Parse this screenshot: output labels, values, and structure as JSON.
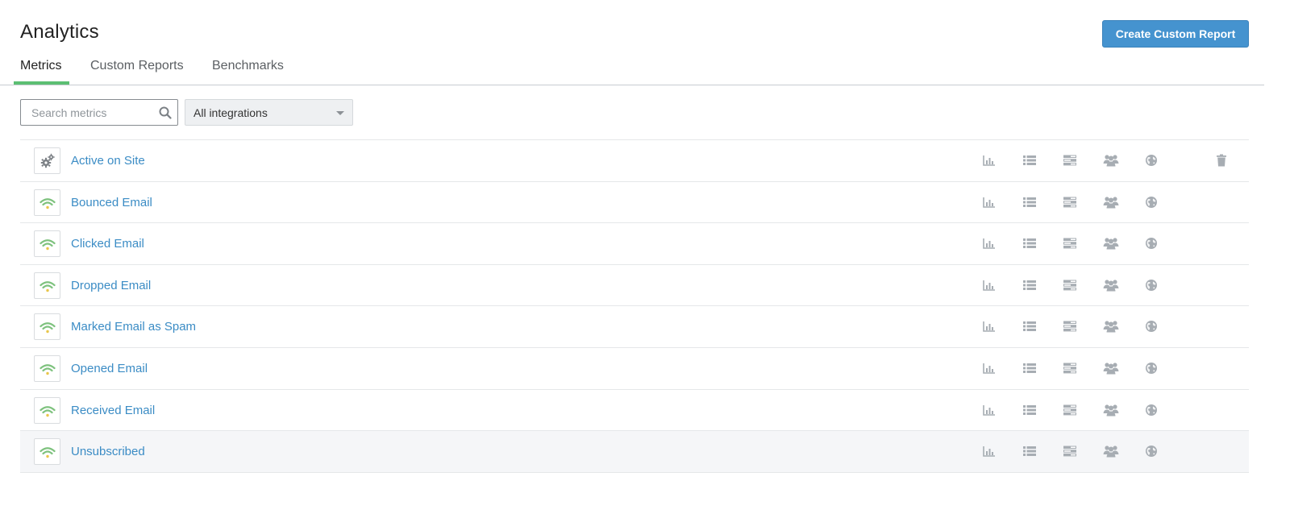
{
  "header": {
    "title": "Analytics",
    "create_button_label": "Create Custom Report"
  },
  "tabs": [
    {
      "label": "Metrics",
      "active": true
    },
    {
      "label": "Custom Reports",
      "active": false
    },
    {
      "label": "Benchmarks",
      "active": false
    }
  ],
  "filters": {
    "search_placeholder": "Search metrics",
    "search_value": "",
    "integration_select": "All integrations"
  },
  "colors": {
    "accent_blue": "#4593cf",
    "tab_active_green": "#5cbf73",
    "link_blue": "#3b8cc5",
    "icon_gray": "#a7adb3"
  },
  "metrics": [
    {
      "name": "Active on Site",
      "icon": "gears-icon",
      "deletable": true
    },
    {
      "name": "Bounced Email",
      "icon": "wifi-signal-icon",
      "deletable": false
    },
    {
      "name": "Clicked Email",
      "icon": "wifi-signal-icon",
      "deletable": false
    },
    {
      "name": "Dropped Email",
      "icon": "wifi-signal-icon",
      "deletable": false
    },
    {
      "name": "Marked Email as Spam",
      "icon": "wifi-signal-icon",
      "deletable": false
    },
    {
      "name": "Opened Email",
      "icon": "wifi-signal-icon",
      "deletable": false
    },
    {
      "name": "Received Email",
      "icon": "wifi-signal-icon",
      "deletable": false
    },
    {
      "name": "Unsubscribed",
      "icon": "wifi-signal-icon",
      "deletable": false,
      "highlighted": true
    }
  ],
  "row_actions": [
    "bar-chart-icon",
    "list-icon",
    "table-icon",
    "people-icon",
    "globe-icon"
  ]
}
